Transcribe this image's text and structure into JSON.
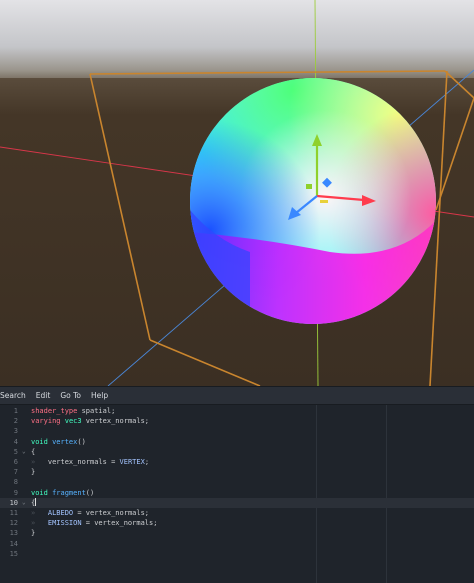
{
  "colors": {
    "sky_top": "#e1e1e4",
    "horizon": "#8a8479",
    "ground": "#3e3226",
    "x_axis": "#d9364a",
    "z_axis": "#4a86d6",
    "y_axis": "#9ccc3c",
    "bbox": "#d2892f",
    "editor_bg": "#1f242b",
    "keyword": "#ff7085",
    "type": "#42ffc2",
    "function": "#57b3ff"
  },
  "menu": [
    "Search",
    "Edit",
    "Go To",
    "Help"
  ],
  "editor": {
    "current_line": 10,
    "lines": [
      {
        "n": "1",
        "fold": "",
        "tokens": [
          {
            "t": "shader_type",
            "c": "kw"
          },
          {
            "t": " spatial;",
            "c": ""
          }
        ]
      },
      {
        "n": "2",
        "fold": "",
        "tokens": [
          {
            "t": "varying",
            "c": "kw"
          },
          {
            "t": " ",
            "c": ""
          },
          {
            "t": "vec3",
            "c": "ty"
          },
          {
            "t": " vertex_normals;",
            "c": ""
          }
        ]
      },
      {
        "n": "3",
        "fold": "",
        "tokens": []
      },
      {
        "n": "4",
        "fold": "",
        "tokens": [
          {
            "t": "void",
            "c": "ty"
          },
          {
            "t": " ",
            "c": ""
          },
          {
            "t": "vertex",
            "c": "fn"
          },
          {
            "t": "()",
            "c": ""
          }
        ]
      },
      {
        "n": "5",
        "fold": "v",
        "tokens": [
          {
            "t": "{",
            "c": ""
          }
        ]
      },
      {
        "n": "6",
        "fold": "",
        "tab": true,
        "tokens": [
          {
            "t": "vertex_normals = ",
            "c": ""
          },
          {
            "t": "VERTEX",
            "c": "bi"
          },
          {
            "t": ";",
            "c": ""
          }
        ]
      },
      {
        "n": "7",
        "fold": "",
        "tokens": [
          {
            "t": "}",
            "c": ""
          }
        ]
      },
      {
        "n": "8",
        "fold": "",
        "tokens": []
      },
      {
        "n": "9",
        "fold": "",
        "tokens": [
          {
            "t": "void",
            "c": "ty"
          },
          {
            "t": " ",
            "c": ""
          },
          {
            "t": "fragment",
            "c": "fn"
          },
          {
            "t": "()",
            "c": ""
          }
        ]
      },
      {
        "n": "10",
        "fold": "v",
        "caret": true,
        "tokens": [
          {
            "t": "{",
            "c": ""
          }
        ]
      },
      {
        "n": "11",
        "fold": "",
        "tab": true,
        "tokens": [
          {
            "t": "ALBEDO",
            "c": "bi"
          },
          {
            "t": " = vertex_normals;",
            "c": ""
          }
        ]
      },
      {
        "n": "12",
        "fold": "",
        "tab": true,
        "tokens": [
          {
            "t": "EMISSION",
            "c": "bi"
          },
          {
            "t": " = vertex_normals;",
            "c": ""
          }
        ]
      },
      {
        "n": "13",
        "fold": "",
        "tokens": [
          {
            "t": "}",
            "c": ""
          }
        ]
      },
      {
        "n": "14",
        "fold": "",
        "tokens": []
      },
      {
        "n": "15",
        "fold": "",
        "tokens": []
      }
    ]
  }
}
